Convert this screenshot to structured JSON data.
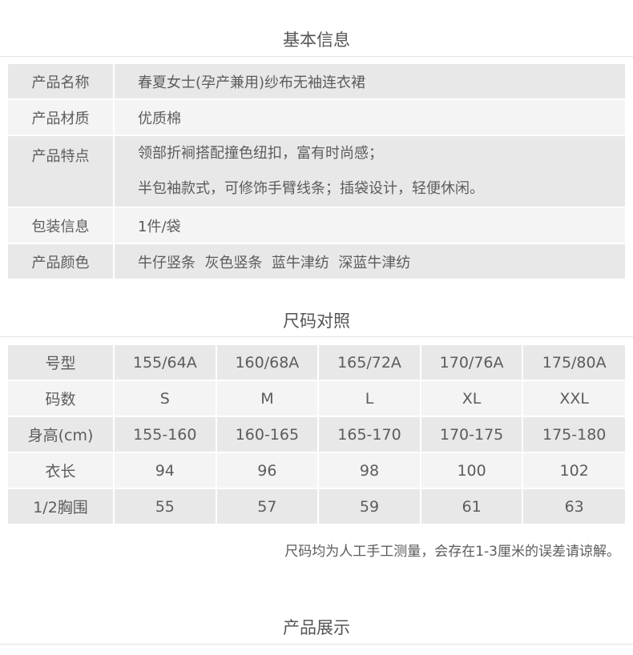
{
  "sections": {
    "basic_info_title": "基本信息",
    "size_chart_title": "尺码对照",
    "product_show_title": "产品展示"
  },
  "basic_info": {
    "name_label": "产品名称",
    "name_value": "春夏女士(孕产兼用)纱布无袖连衣裙",
    "material_label": "产品材质",
    "material_value": "优质棉",
    "features_label": "产品特点",
    "features_lines": [
      "领部折裥搭配撞色纽扣，富有时尚感；",
      "半包袖款式，可修饰手臂线条；插袋设计，轻便休闲。"
    ],
    "packaging_label": "包装信息",
    "packaging_value": "1件/袋",
    "colors_label": "产品颜色",
    "colors_value": "牛仔竖条  灰色竖条  蓝牛津纺  深蓝牛津纺"
  },
  "size_chart": {
    "rows": [
      {
        "label": "号型",
        "values": [
          "155/64A",
          "160/68A",
          "165/72A",
          "170/76A",
          "175/80A"
        ]
      },
      {
        "label": "码数",
        "values": [
          "S",
          "M",
          "L",
          "XL",
          "XXL"
        ]
      },
      {
        "label": "身高(cm)",
        "values": [
          "155-160",
          "160-165",
          "165-170",
          "170-175",
          "175-180"
        ]
      },
      {
        "label": "衣长",
        "values": [
          "94",
          "96",
          "98",
          "100",
          "102"
        ]
      },
      {
        "label": "1/2胸围",
        "values": [
          "55",
          "57",
          "59",
          "61",
          "63"
        ]
      }
    ],
    "note": "尺码均为人工手工测量，会存在1-3厘米的误差请谅解。"
  }
}
